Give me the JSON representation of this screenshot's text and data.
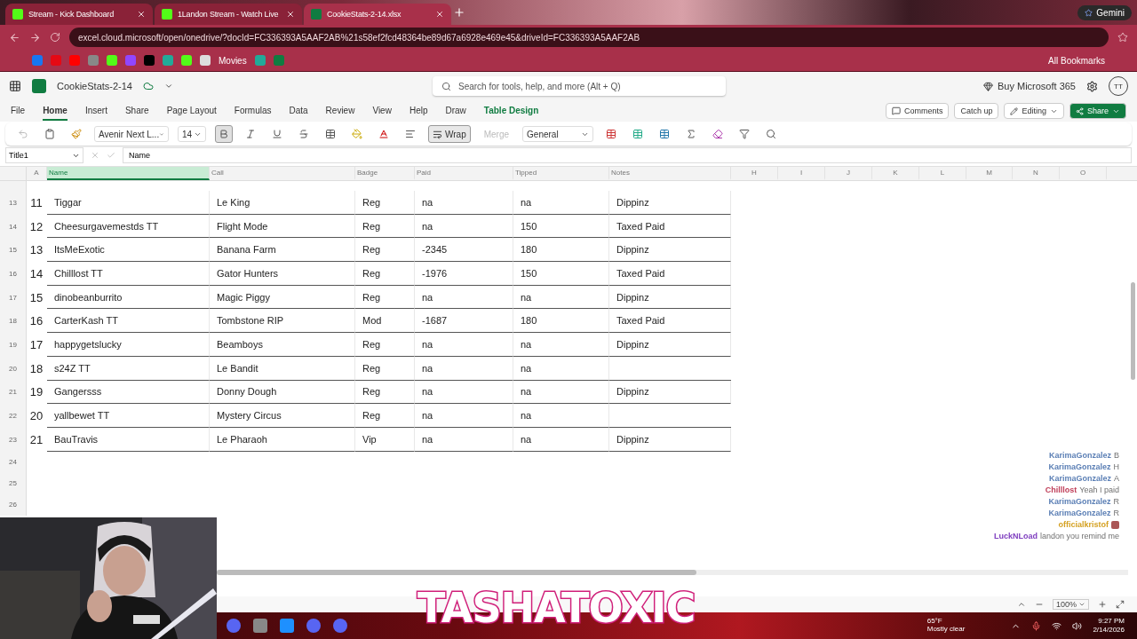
{
  "browser": {
    "tabs": [
      {
        "title": "Stream - Kick Dashboard",
        "kind": "kick",
        "selected": false
      },
      {
        "title": "1Landon Stream - Watch Live",
        "kind": "kick",
        "selected": false
      },
      {
        "title": "CookieStats-2-14.xlsx",
        "kind": "excel",
        "selected": true
      }
    ],
    "gemini": "Gemini",
    "address": "excel.cloud.microsoft/open/onedrive/?docId=FC336393A5AAF2AB%21s58ef2fcd48364be89d67a6928e469e45&driveId=FC336393A5AAF2AB",
    "bookmark_label": "Movies",
    "all_bookmarks": "All Bookmarks"
  },
  "excel": {
    "file_name": "CookieStats-2-14",
    "search_placeholder": "Search for tools, help, and more (Alt + Q)",
    "buy": "Buy Microsoft 365",
    "avatar": "TT",
    "menu": [
      {
        "label": "File",
        "selected": false
      },
      {
        "label": "Home",
        "selected": true
      },
      {
        "label": "Insert",
        "selected": false
      },
      {
        "label": "Share",
        "selected": false
      },
      {
        "label": "Page Layout",
        "selected": false
      },
      {
        "label": "Formulas",
        "selected": false
      },
      {
        "label": "Data",
        "selected": false
      },
      {
        "label": "Review",
        "selected": false
      },
      {
        "label": "View",
        "selected": false
      },
      {
        "label": "Help",
        "selected": false
      },
      {
        "label": "Draw",
        "selected": false
      },
      {
        "label": "Table Design",
        "selected": false
      }
    ],
    "actions": {
      "comments": "Comments",
      "catch_up": "Catch up",
      "editing": "Editing",
      "share": "Share"
    },
    "toolbar": {
      "font": "Avenir Next L...",
      "size": "14",
      "bold": true,
      "wrap": "Wrap",
      "merge": "Merge",
      "number_format": "General"
    },
    "name_box": "Title1",
    "formula": "Name"
  },
  "sheet": {
    "columns": [
      {
        "label": "A",
        "selected": false
      },
      {
        "label": "Name",
        "selected": true
      },
      {
        "label": "Call",
        "selected": false
      },
      {
        "label": "Badge",
        "selected": false
      },
      {
        "label": "Paid",
        "selected": false
      },
      {
        "label": "Tipped",
        "selected": false
      },
      {
        "label": "Notes",
        "selected": false
      },
      {
        "label": "H",
        "selected": false
      },
      {
        "label": "I",
        "selected": false
      },
      {
        "label": "J",
        "selected": false
      },
      {
        "label": "K",
        "selected": false
      },
      {
        "label": "L",
        "selected": false
      },
      {
        "label": "M",
        "selected": false
      },
      {
        "label": "N",
        "selected": false
      },
      {
        "label": "O",
        "selected": false
      }
    ],
    "rows": [
      {
        "row": "13",
        "no": "11",
        "name": "Tiggar",
        "call": "Le King",
        "badge": "Reg",
        "paid": "na",
        "tipped": "na",
        "notes": "Dippinz"
      },
      {
        "row": "14",
        "no": "12",
        "name": "Cheesurgavemestds TT",
        "call": "Flight Mode",
        "badge": "Reg",
        "paid": "na",
        "tipped": "150",
        "notes": "Taxed Paid"
      },
      {
        "row": "15",
        "no": "13",
        "name": "ItsMeExotic",
        "call": "Banana Farm",
        "badge": "Reg",
        "paid": "-2345",
        "tipped": "180",
        "notes": "Dippinz"
      },
      {
        "row": "16",
        "no": "14",
        "name": "Chilllost TT",
        "call": "Gator Hunters",
        "badge": "Reg",
        "paid": "-1976",
        "tipped": "150",
        "notes": "Taxed Paid"
      },
      {
        "row": "17",
        "no": "15",
        "name": "dinobeanburrito",
        "call": "Magic Piggy",
        "badge": "Reg",
        "paid": "na",
        "tipped": "na",
        "notes": "Dippinz"
      },
      {
        "row": "18",
        "no": "16",
        "name": "CarterKash TT",
        "call": "Tombstone RIP",
        "badge": "Mod",
        "paid": "-1687",
        "tipped": "180",
        "notes": "Taxed Paid"
      },
      {
        "row": "19",
        "no": "17",
        "name": "happygetslucky",
        "call": "Beamboys",
        "badge": "Reg",
        "paid": "na",
        "tipped": "na",
        "notes": "Dippinz"
      },
      {
        "row": "20",
        "no": "18",
        "name": "s24Z TT",
        "call": "Le Bandit",
        "badge": "Reg",
        "paid": "na",
        "tipped": "na"
      },
      {
        "row": "21",
        "no": "19",
        "name": "Gangersss",
        "call": "Donny Dough",
        "badge": "Reg",
        "paid": "na",
        "tipped": "na",
        "notes": "Dippinz"
      },
      {
        "row": "22",
        "no": "20",
        "name": "yallbewet TT",
        "call": "Mystery Circus",
        "badge": "Reg",
        "paid": "na",
        "tipped": "na"
      },
      {
        "row": "23",
        "no": "21",
        "name": "BauTravis",
        "call": "Le Pharaoh",
        "badge": "Vip",
        "paid": "na",
        "tipped": "na",
        "notes": "Dippinz"
      }
    ],
    "empty_rows": [
      "24",
      "25",
      "26"
    ],
    "zoom": "100%"
  },
  "chat": [
    {
      "user": "KarimaGonzalez",
      "message": "B",
      "color": "#5b7fb5"
    },
    {
      "user": "KarimaGonzalez",
      "message": "H",
      "color": "#5b7fb5"
    },
    {
      "user": "KarimaGonzalez",
      "message": "A",
      "color": "#5b7fb5"
    },
    {
      "user": "Chilllost",
      "message": "Yeah I paid",
      "color": "#c0405a"
    },
    {
      "user": "KarimaGonzalez",
      "message": "R",
      "color": "#5b7fb5"
    },
    {
      "user": "KarimaGonzalez",
      "message": "R",
      "color": "#5b7fb5"
    },
    {
      "user": "officialkristof",
      "color": "#d4a020"
    },
    {
      "user": "LuckNLoad",
      "message": "landon you remind me",
      "color": "#8040c0"
    }
  ],
  "overlay_title": "TASHATOXIC",
  "taskbar": {
    "temperature": "65°F",
    "weather": "Mostly clear",
    "time": "9:27 PM",
    "date": "2/14/2026"
  }
}
